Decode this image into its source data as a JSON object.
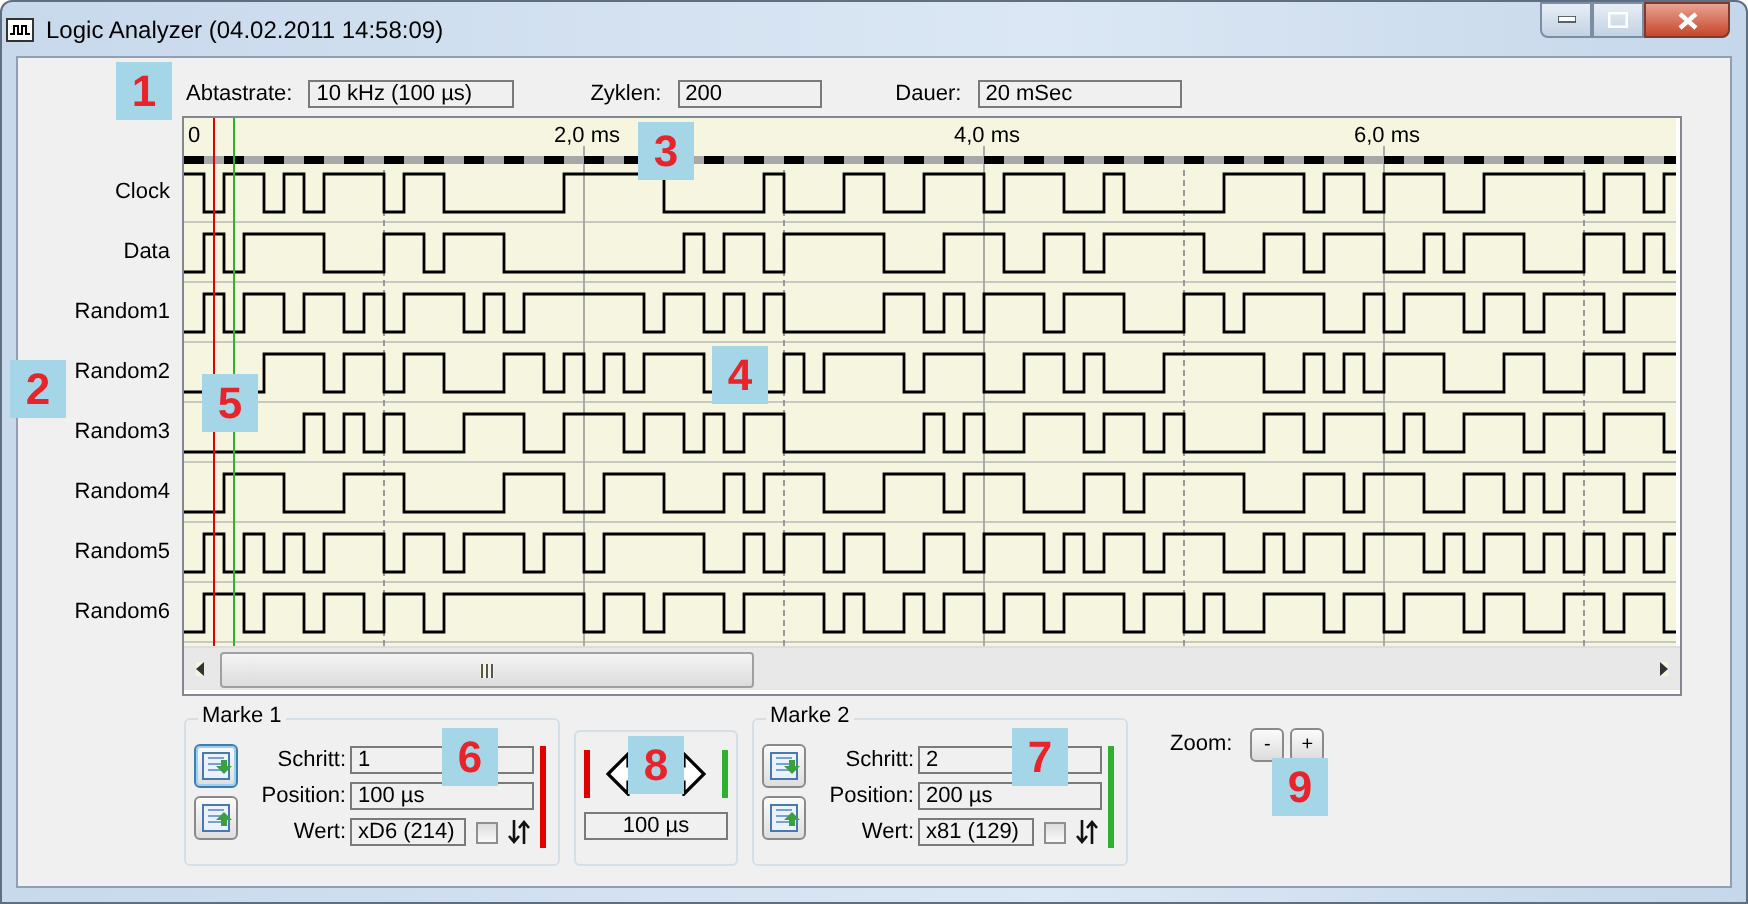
{
  "window": {
    "title": "Logic Analyzer (04.02.2011 14:58:09)"
  },
  "settings": [
    {
      "label": "Abtastrate:",
      "value": "10 kHz (100 µs)"
    },
    {
      "label": "Zyklen:",
      "value": "200"
    },
    {
      "label": "Dauer:",
      "value": "20 mSec"
    }
  ],
  "time_axis": {
    "labels": [
      "0",
      "2,0 ms",
      "4,0 ms",
      "6,0 ms"
    ]
  },
  "channels": [
    {
      "name": "Clock"
    },
    {
      "name": "Data"
    },
    {
      "name": "Random1"
    },
    {
      "name": "Random2"
    },
    {
      "name": "Random3"
    },
    {
      "name": "Random4"
    },
    {
      "name": "Random5"
    },
    {
      "name": "Random6"
    }
  ],
  "markers": [
    {
      "title": "Marke 1",
      "color": "#e00000",
      "fields": [
        {
          "label": "Schritt:",
          "value": "1"
        },
        {
          "label": "Position:",
          "value": "100 µs"
        },
        {
          "label": "Wert:",
          "value": "xD6 (214)"
        }
      ],
      "checked": false,
      "focused": true
    },
    {
      "title": "Marke 2",
      "color": "#30b030",
      "fields": [
        {
          "label": "Schritt:",
          "value": "2"
        },
        {
          "label": "Position:",
          "value": "200 µs"
        },
        {
          "label": "Wert:",
          "value": "x81 (129)"
        }
      ],
      "checked": false,
      "focused": false
    }
  ],
  "difference": {
    "value": "100 µs"
  },
  "zoom": {
    "label": "Zoom:",
    "buttons": [
      "-",
      "+"
    ]
  },
  "callouts": [
    "1",
    "2",
    "3",
    "4",
    "5",
    "6",
    "8",
    "7",
    "9"
  ]
}
